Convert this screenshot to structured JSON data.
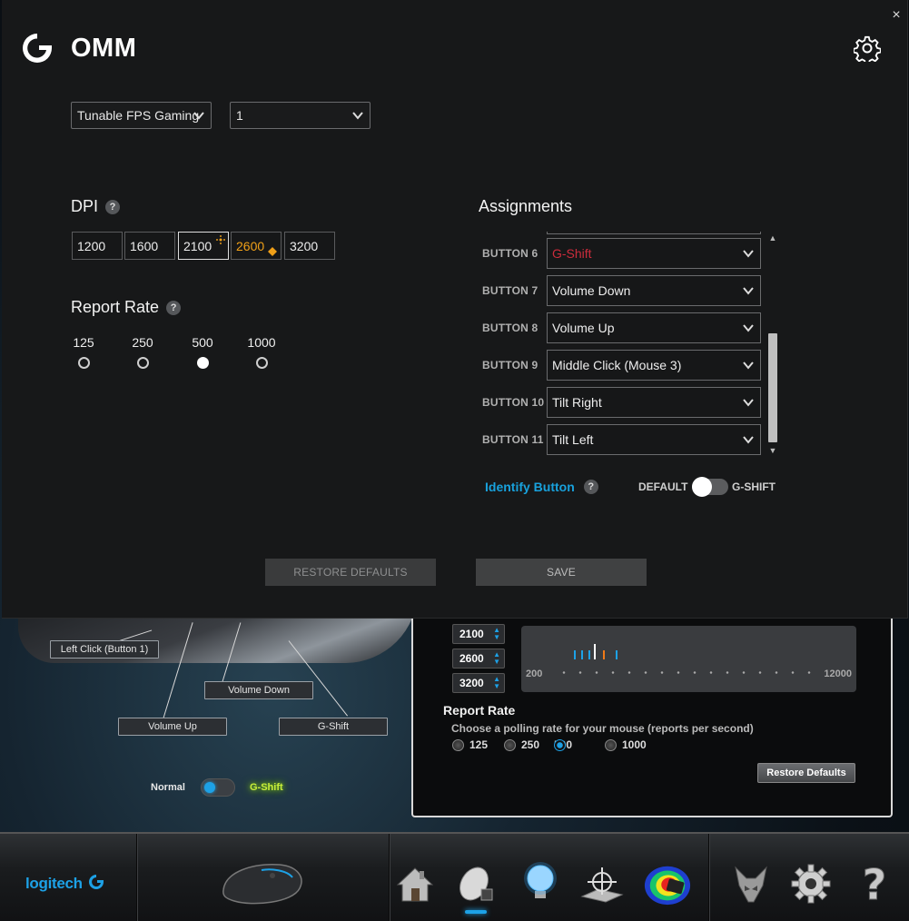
{
  "dialog": {
    "title": "OMM",
    "close_glyph": "×",
    "profile_select": "Tunable FPS Gaming",
    "slot_select": "1",
    "dpi": {
      "title": "DPI",
      "help": "?",
      "levels": [
        "1200",
        "1600",
        "2100",
        "2600",
        "3200"
      ],
      "active_index": 2,
      "default_index": 3
    },
    "report_rate": {
      "title": "Report Rate",
      "help": "?",
      "options": [
        "125",
        "250",
        "500",
        "1000"
      ],
      "selected": "500"
    },
    "assignments": {
      "title": "Assignments",
      "rows": [
        {
          "label": "BUTTON 6",
          "value": "G-Shift"
        },
        {
          "label": "BUTTON 7",
          "value": "Volume Down"
        },
        {
          "label": "BUTTON 8",
          "value": "Volume Up"
        },
        {
          "label": "BUTTON 9",
          "value": "Middle Click (Mouse 3)"
        },
        {
          "label": "BUTTON 10",
          "value": "Tilt Right"
        },
        {
          "label": "BUTTON 11",
          "value": "Tilt Left"
        }
      ]
    },
    "identify_button": "Identify Button",
    "identify_help": "?",
    "toggle_default": "DEFAULT",
    "toggle_gshift": "G-SHIFT",
    "restore_defaults": "RESTORE DEFAULTS",
    "save": "SAVE"
  },
  "background_app": {
    "callouts": {
      "left_click": "Left Click (Button 1)",
      "volume_down": "Volume Down",
      "volume_up": "Volume Up",
      "g_shift": "G-Shift"
    },
    "mode_normal": "Normal",
    "mode_gshift": "G-Shift",
    "dpi_levels": [
      "2100",
      "2600",
      "3200"
    ],
    "dpi_min": "200",
    "dpi_max": "12000",
    "report_rate": {
      "title": "Report Rate",
      "subtitle": "Choose a polling rate for your mouse (reports per second)",
      "options": [
        "125",
        "250",
        "500",
        "1000"
      ],
      "selected": "500"
    },
    "restore_defaults": "Restore Defaults",
    "brand": "logitech",
    "toolbar_icons": [
      "mouse-product-icon",
      "home-icon",
      "pointer-settings-icon",
      "lighting-bulb-icon",
      "surface-tuning-icon",
      "heatmap-icon",
      "arx-control-icon",
      "settings-gear-icon",
      "help-icon"
    ]
  },
  "colors": {
    "accent_blue": "#18a1dc",
    "gshift_red": "#cc2c3c",
    "dpi_default_orange": "#f0a018",
    "gshift_green": "#c7ee3a"
  }
}
